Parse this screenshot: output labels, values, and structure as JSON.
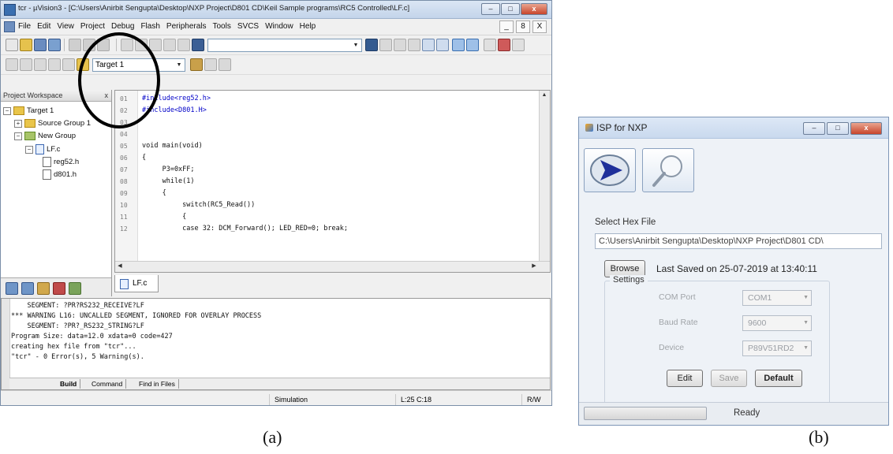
{
  "figure_a": {
    "caption": "(a)",
    "window_title": "tcr - µVision3 - [C:\\Users\\Anirbit Sengupta\\Desktop\\NXP Project\\D801 CD\\Keil Sample programs\\RC5 Controlled\\LF.c]",
    "menu": [
      "File",
      "Edit",
      "View",
      "Project",
      "Debug",
      "Flash",
      "Peripherals",
      "Tools",
      "SVCS",
      "Window",
      "Help"
    ],
    "mdi_buttons": [
      "_",
      "8",
      "X"
    ],
    "target_combo": "Target 1",
    "project_workspace_title": "Project Workspace",
    "project_workspace_close": "x",
    "tree": [
      {
        "label": "Target 1",
        "expander": "−"
      },
      {
        "label": "Source Group 1",
        "expander": "+"
      },
      {
        "label": "New Group",
        "expander": "−"
      },
      {
        "label": "LF.c",
        "expander": "−"
      },
      {
        "label": "reg52.h",
        "expander": ""
      },
      {
        "label": "d801.h",
        "expander": ""
      }
    ],
    "code_lines": [
      {
        "num": "01",
        "text": "#include<reg52.h>"
      },
      {
        "num": "02",
        "text": "#include<D801.H>"
      },
      {
        "num": "03",
        "text": ""
      },
      {
        "num": "04",
        "text": ""
      },
      {
        "num": "05",
        "text": "void main(void)"
      },
      {
        "num": "06",
        "text": "{"
      },
      {
        "num": "07",
        "text": "     P3=0xFF;"
      },
      {
        "num": "08",
        "text": "     while(1)"
      },
      {
        "num": "09",
        "text": "     {"
      },
      {
        "num": "10",
        "text": "          switch(RC5_Read())"
      },
      {
        "num": "11",
        "text": "          {"
      },
      {
        "num": "12",
        "text": "          case 32: DCM_Forward(); LED_RED=0; break;"
      }
    ],
    "editor_tab": "LF.c",
    "output_lines": [
      "    SEGMENT: ?PR?RS232_RECEIVE?LF",
      "*** WARNING L16: UNCALLED SEGMENT, IGNORED FOR OVERLAY PROCESS",
      "    SEGMENT: ?PR?_RS232_STRING?LF",
      "Program Size: data=12.0 xdata=0 code=427",
      "creating hex file from \"tcr\"...",
      "\"tcr\" - 0 Error(s), 5 Warning(s)."
    ],
    "output_tabs": [
      "Build",
      "Command",
      "Find in Files"
    ],
    "status": {
      "mode": "Simulation",
      "position": "L:25 C:18",
      "rw": "R/W"
    }
  },
  "figure_b": {
    "caption": "(b)",
    "window_title": "ISP for NXP",
    "select_hex_label": "Select Hex File",
    "path": "C:\\Users\\Anirbit Sengupta\\Desktop\\NXP Project\\D801 CD\\",
    "browse_button": "Browse",
    "last_saved": "Last Saved on 25-07-2019 at 13:40:11",
    "settings_title": "Settings",
    "com_port_label": "COM Port",
    "com_port_value": "COM1",
    "baud_rate_label": "Baud Rate",
    "baud_rate_value": "9600",
    "device_label": "Device",
    "device_value": "P89V51RD2",
    "edit_button": "Edit",
    "save_button": "Save",
    "default_button": "Default",
    "status_text": "Ready",
    "progress": 0
  }
}
